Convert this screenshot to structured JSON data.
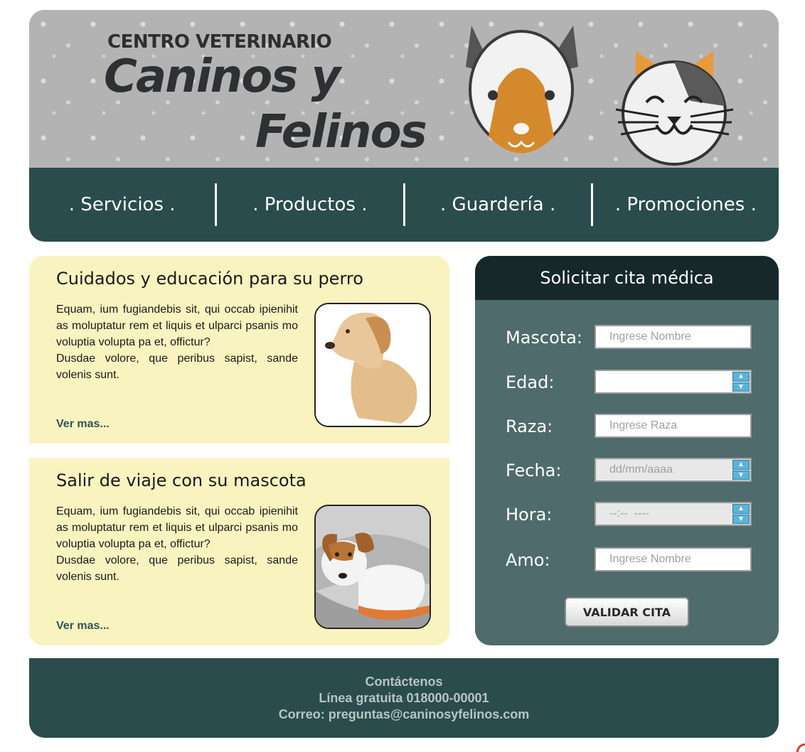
{
  "header": {
    "brand_top": "CENTRO VETERINARIO",
    "brand_main": "Caninos y",
    "brand_sub": "Felinos"
  },
  "nav": {
    "items": [
      ". Servicios .",
      ". Productos .",
      ". Guardería .",
      ". Promociones ."
    ]
  },
  "articles": [
    {
      "title": "Cuidados y educación para su perro",
      "body": "Equam, ium fugiandebis sit, qui occab ipienihit as moluptatur rem et liquis et ulparci psanis mo voluptia volupta pa et, offictur?\nDusdae volore, que peribus sapist, sande volenis sunt.",
      "more": "Ver mas..."
    },
    {
      "title": "Salir de viaje con su mascota",
      "body": "Equam, ium fugiandebis sit, qui occab ipienihit as moluptatur rem et liquis et ulparci psanis mo voluptia volupta pa et, offictur?\nDusdae volore, que peribus sapist, sande volenis sunt.",
      "more": "Ver mas..."
    }
  ],
  "form": {
    "title": "Solicitar cita médica",
    "fields": [
      {
        "label": "Mascota:",
        "placeholder": "Ingrese Nombre"
      },
      {
        "label": "Edad:",
        "placeholder": ""
      },
      {
        "label": "Raza:",
        "placeholder": "Ingrese Raza"
      },
      {
        "label": "Fecha:",
        "placeholder": "dd/mm/aaaa"
      },
      {
        "label": "Hora:",
        "placeholder": "--:--  ----"
      },
      {
        "label": "Amo:",
        "placeholder": "Ingrese Nombre"
      }
    ],
    "submit": "VALIDAR CITA"
  },
  "footer": {
    "line1": "Contáctenos",
    "line2": "Línea gratuita 018000-00001",
    "line3": "Correo: preguntas@caninosyfelinos.com"
  },
  "colors": {
    "header_teal": "#2a4c4c",
    "card_yellow": "#f9f3c0",
    "form_bg": "#4f6b6b",
    "form_header": "#16282a"
  }
}
